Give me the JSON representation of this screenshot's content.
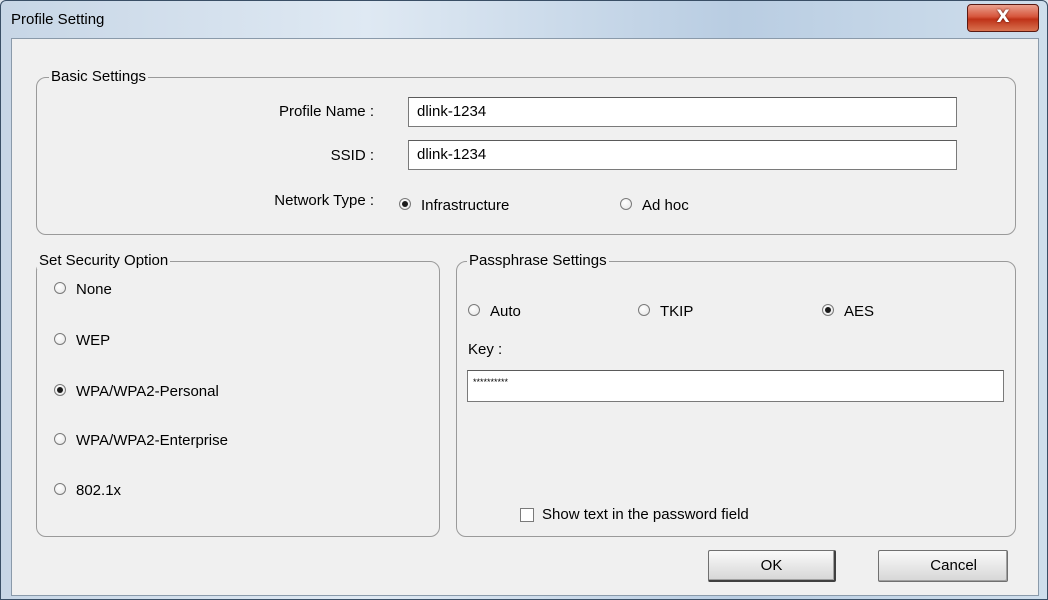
{
  "window": {
    "title": "Profile Setting",
    "close_glyph": "X"
  },
  "basic": {
    "legend": "Basic Settings",
    "profile_name_label": "Profile Name :",
    "profile_name_value": "dlink-1234",
    "ssid_label": "SSID :",
    "ssid_value": "dlink-1234",
    "network_type_label": "Network Type :",
    "network_options": [
      {
        "label": "Infrastructure",
        "selected": true
      },
      {
        "label": "Ad hoc",
        "selected": false
      }
    ]
  },
  "security": {
    "legend": "Set Security Option",
    "options": [
      {
        "label": "None",
        "selected": false
      },
      {
        "label": "WEP",
        "selected": false
      },
      {
        "label": "WPA/WPA2-Personal",
        "selected": true
      },
      {
        "label": "WPA/WPA2-Enterprise",
        "selected": false
      },
      {
        "label": "802.1x",
        "selected": false
      }
    ]
  },
  "passphrase": {
    "legend": "Passphrase Settings",
    "cipher_options": [
      {
        "label": "Auto",
        "selected": false
      },
      {
        "label": "TKIP",
        "selected": false
      },
      {
        "label": "AES",
        "selected": true
      }
    ],
    "key_label": "Key :",
    "key_value": "**********",
    "show_text_label": "Show text in the password field",
    "show_text_checked": false
  },
  "buttons": {
    "ok": "OK",
    "cancel": "Cancel"
  }
}
